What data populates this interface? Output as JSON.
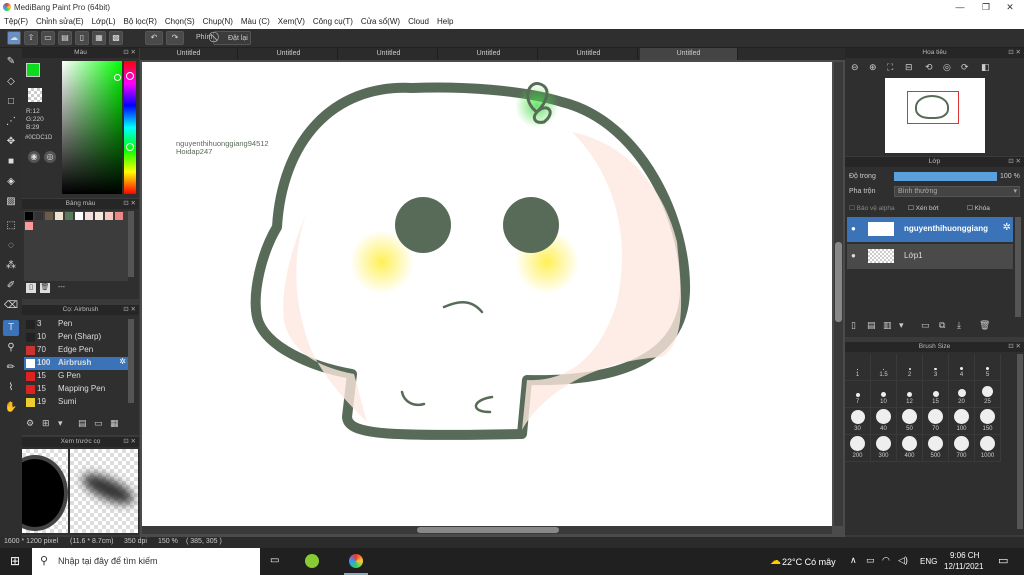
{
  "app": {
    "title": "MediBang Paint Pro (64bit)"
  },
  "menu": [
    "Tệp(F)",
    "Chỉnh sửa(E)",
    "Lớp(L)",
    "Bộ lọc(R)",
    "Chọn(S)",
    "Chụp(N)",
    "Màu (C)",
    "Xem(V)",
    "Công cụ(T)",
    "Cửa sổ(W)",
    "Cloud",
    "Help"
  ],
  "toolbar": {
    "key_label": "Phím",
    "reset_label": "Đặt lại"
  },
  "color_panel": {
    "title": "Màu",
    "r": "R:12",
    "g": "G:220",
    "b": "B:29",
    "hex": "#0CDC1D",
    "primary": "#0cdc1d"
  },
  "palette_panel": {
    "title": "Bảng màu",
    "range": "---"
  },
  "brush_panel": {
    "title": "Cọ: Airbrush",
    "items": [
      {
        "size": "3",
        "name": "Pen",
        "color": "#222222"
      },
      {
        "size": "10",
        "name": "Pen (Sharp)",
        "color": "#222222"
      },
      {
        "size": "70",
        "name": "Edge Pen",
        "color": "#cc3333"
      },
      {
        "size": "100",
        "name": "Airbrush",
        "color": "#ffffff"
      },
      {
        "size": "15",
        "name": "G Pen",
        "color": "#dd2222"
      },
      {
        "size": "15",
        "name": "Mapping Pen",
        "color": "#dd2222"
      },
      {
        "size": "19",
        "name": "Sumi",
        "color": "#eecc33"
      }
    ]
  },
  "preview_panel": {
    "title": "Xem trước cọ"
  },
  "tabs": [
    "Untitled",
    "Untitled",
    "Untitled",
    "Untitled",
    "Untitled",
    "Untitled"
  ],
  "canvas": {
    "watermark1": "nguyenthihuonggiang94512",
    "watermark2": "Hoidap247"
  },
  "navigator": {
    "title": "Hoa tiêu"
  },
  "layer_panel": {
    "title": "Lớp",
    "opacity_label": "Độ trong",
    "opacity_value": "100 %",
    "blend_label": "Pha trộn",
    "blend_value": "Bình thường",
    "protect_alpha": "Bảo vệ alpha",
    "clip": "Xén bớt",
    "lock": "Khóa",
    "layers": [
      {
        "name": "nguyenthihuonggiang"
      },
      {
        "name": "Lớp1"
      }
    ]
  },
  "brush_size": {
    "title": "Brush Size",
    "sizes": [
      "1",
      "1.5",
      "2",
      "3",
      "4",
      "5",
      "7",
      "10",
      "12",
      "15",
      "20",
      "25",
      "30",
      "40",
      "50",
      "70",
      "100",
      "150",
      "200",
      "300",
      "400",
      "500",
      "700",
      "1000"
    ]
  },
  "status": {
    "dims": "1600 * 1200 pixel",
    "cm": "(11.6 * 8.7cm)",
    "dpi": "350 dpi",
    "zoom": "150 %",
    "coords": "( 385, 305 )"
  },
  "taskbar": {
    "search": "Nhập tại đây để tìm kiếm",
    "weather": "22°C Có mây",
    "lang": "ENG",
    "time": "9:06 CH",
    "date": "12/11/2021"
  }
}
